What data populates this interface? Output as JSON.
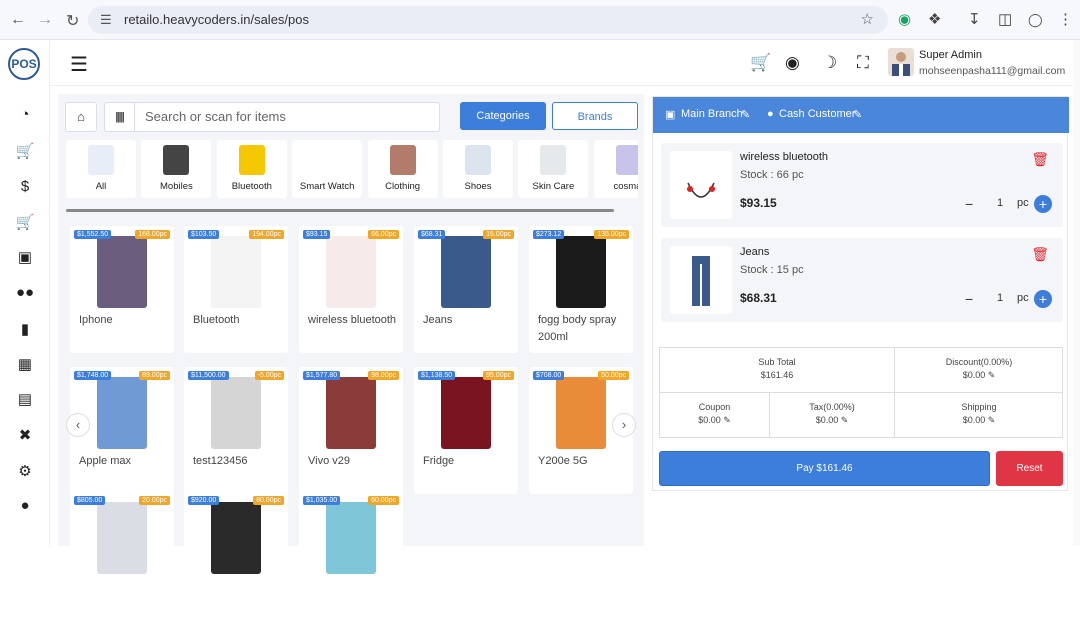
{
  "browser": {
    "url": "retailo.heavycoders.in/sales/pos"
  },
  "logo_text": "POS",
  "user": {
    "name": "Super Admin",
    "email": "mohseenpasha111@gmail.com"
  },
  "search": {
    "placeholder": "Search or scan for items"
  },
  "filters": {
    "categories": "Categories",
    "brands": "Brands"
  },
  "categories": [
    {
      "label": "All",
      "color": "#e8eef8"
    },
    {
      "label": "Mobiles",
      "color": "#444"
    },
    {
      "label": "Bluetooth",
      "color": "#f3c800"
    },
    {
      "label": "Smart Watch",
      "color": "#fff"
    },
    {
      "label": "Clothing",
      "color": "#b27b6b"
    },
    {
      "label": "Shoes",
      "color": "#dce4ee"
    },
    {
      "label": "Skin Care",
      "color": "#e5e9ec"
    },
    {
      "label": "cosmat",
      "color": "#c8c3e8"
    }
  ],
  "products": [
    {
      "name": "Iphone",
      "price": "$1,552.50",
      "stock": "168.00pc",
      "color": "#6b5d7e"
    },
    {
      "name": "Bluetooth",
      "price": "$103.50",
      "stock": "194.00pc",
      "color": "#f4f4f4"
    },
    {
      "name": "wireless bluetooth",
      "price": "$93.15",
      "stock": "66.00pc",
      "color": "#f7eaea"
    },
    {
      "name": "Jeans",
      "price": "$68.31",
      "stock": "15.00pc",
      "color": "#3a5a8c"
    },
    {
      "name": "fogg body spray 200ml",
      "price": "$273.12",
      "stock": "135.00pc",
      "color": "#1b1b1b"
    },
    {
      "name": "Apple max",
      "price": "$1,748.00",
      "stock": "89.00pc",
      "color": "#6f9ad4"
    },
    {
      "name": "test123456",
      "price": "$11,500.00",
      "stock": "-5.00pc",
      "color": "#d5d5d5"
    },
    {
      "name": "Vivo v29",
      "price": "$1,577.80",
      "stock": "98.00pc",
      "color": "#8c3b3b"
    },
    {
      "name": "Fridge",
      "price": "$1,138.50",
      "stock": "95.00pc",
      "color": "#7a1420"
    },
    {
      "name": "Y200e 5G",
      "price": "$708.00",
      "stock": "50.00pc",
      "color": "#e98c3a"
    },
    {
      "name": "",
      "price": "$805.00",
      "stock": "20.00pc",
      "color": "#dadde3"
    },
    {
      "name": "",
      "price": "$920.00",
      "stock": "80.00pc",
      "color": "#2a2a2a"
    },
    {
      "name": "",
      "price": "$1,035.00",
      "stock": "60.00pc",
      "color": "#7fc6d8"
    }
  ],
  "cart_header": {
    "branch": "Main Branch",
    "customer": "Cash Customer"
  },
  "cart": [
    {
      "name": "wireless bluetooth",
      "stock": "Stock : 66 pc",
      "price": "$93.15",
      "qty": "1",
      "unit": "pc"
    },
    {
      "name": "Jeans",
      "stock": "Stock : 15 pc",
      "price": "$68.31",
      "qty": "1",
      "unit": "pc"
    }
  ],
  "summary": {
    "subtotal_label": "Sub Total",
    "subtotal": "$161.46",
    "discount_label": "Discount(0.00%)",
    "discount": "$0.00",
    "coupon_label": "Coupon",
    "coupon": "$0.00",
    "tax_label": "Tax(0.00%)",
    "tax": "$0.00",
    "shipping_label": "Shipping",
    "shipping": "$0.00"
  },
  "actions": {
    "pay": "Pay  $161.46",
    "reset": "Reset"
  }
}
